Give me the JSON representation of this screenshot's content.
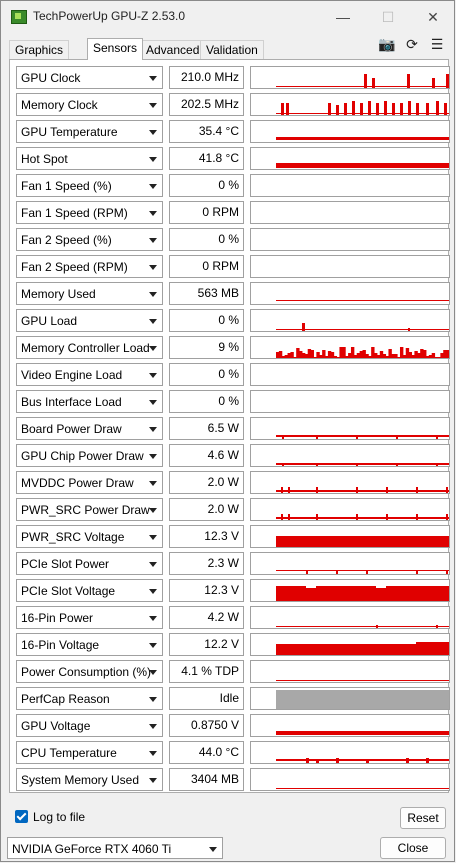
{
  "window": {
    "title": "TechPowerUp GPU-Z 2.53.0",
    "min_glyph": "—",
    "max_glyph": "☐",
    "close_glyph": "✕"
  },
  "tabs": [
    {
      "label": "Graphics Card"
    },
    {
      "label": "Sensors",
      "active": true
    },
    {
      "label": "Advanced"
    },
    {
      "label": "Validation"
    }
  ],
  "toolbar": {
    "camera_glyph": "📷",
    "refresh_glyph": "⟳",
    "menu_glyph": "☰"
  },
  "graph_color": "#e00000",
  "sensors": [
    {
      "name": "GPU Clock",
      "value": "210.0 MHz"
    },
    {
      "name": "Memory Clock",
      "value": "202.5 MHz"
    },
    {
      "name": "GPU Temperature",
      "value": "35.4 °C"
    },
    {
      "name": "Hot Spot",
      "value": "41.8 °C"
    },
    {
      "name": "Fan 1 Speed (%)",
      "value": "0 %"
    },
    {
      "name": "Fan 1 Speed (RPM)",
      "value": "0 RPM"
    },
    {
      "name": "Fan 2 Speed (%)",
      "value": "0 %"
    },
    {
      "name": "Fan 2 Speed (RPM)",
      "value": "0 RPM"
    },
    {
      "name": "Memory Used",
      "value": "563 MB"
    },
    {
      "name": "GPU Load",
      "value": "0 %"
    },
    {
      "name": "Memory Controller Load",
      "value": "9 %"
    },
    {
      "name": "Video Engine Load",
      "value": "0 %"
    },
    {
      "name": "Bus Interface Load",
      "value": "0 %"
    },
    {
      "name": "Board Power Draw",
      "value": "6.5 W"
    },
    {
      "name": "GPU Chip Power Draw",
      "value": "4.6 W"
    },
    {
      "name": "MVDDC Power Draw",
      "value": "2.0 W"
    },
    {
      "name": "PWR_SRC Power Draw",
      "value": "2.0 W"
    },
    {
      "name": "PWR_SRC Voltage",
      "value": "12.3 V"
    },
    {
      "name": "PCIe Slot Power",
      "value": "2.3 W"
    },
    {
      "name": "PCIe Slot Voltage",
      "value": "12.3 V"
    },
    {
      "name": "16-Pin Power",
      "value": "4.2 W"
    },
    {
      "name": "16-Pin Voltage",
      "value": "12.2 V"
    },
    {
      "name": "Power Consumption (%)",
      "value": "4.1 % TDP"
    },
    {
      "name": "PerfCap Reason",
      "value": "Idle"
    },
    {
      "name": "GPU Voltage",
      "value": "0.8750 V"
    },
    {
      "name": "CPU Temperature",
      "value": "44.0 °C"
    },
    {
      "name": "System Memory Used",
      "value": "3404 MB"
    }
  ],
  "footer": {
    "log_label": "Log to file",
    "log_checked": true,
    "reset_label": "Reset",
    "gpu_name": "NVIDIA GeForce RTX 4060 Ti",
    "close_label": "Close"
  }
}
